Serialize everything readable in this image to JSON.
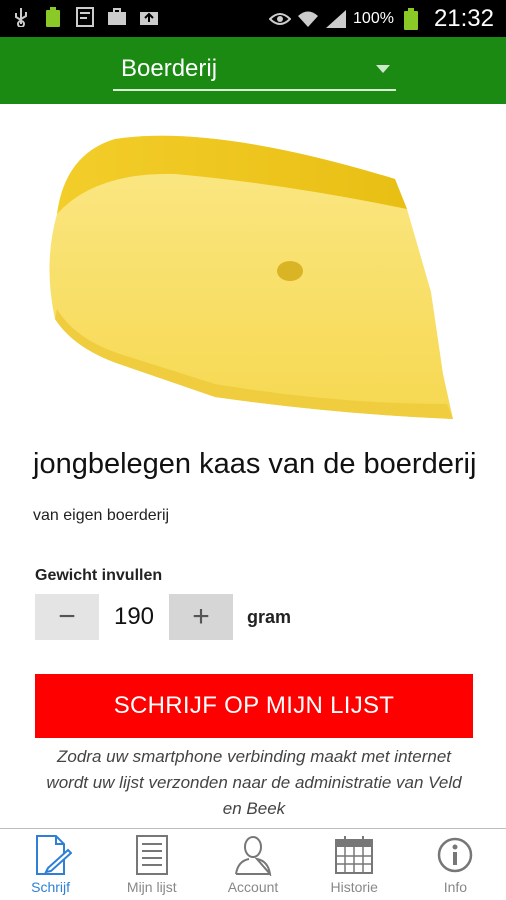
{
  "status_bar": {
    "battery_percent": "100%",
    "time": "21:32",
    "icons": [
      "usb-icon",
      "battery-icon",
      "notification-icon",
      "briefcase-icon",
      "upload-icon",
      "eye-icon",
      "wifi-icon",
      "signal-icon"
    ]
  },
  "app_bar": {
    "selected": "Boerderij",
    "background": "#1a8a12"
  },
  "product": {
    "title": "jongbelegen kaas van de boerderij",
    "subtitle": "van eigen boerderij",
    "image_icon": "cheese-image"
  },
  "weight": {
    "label": "Gewicht invullen",
    "value": "190",
    "unit": "gram",
    "minus_symbol": "−",
    "plus_symbol": "+"
  },
  "submit": {
    "label": "SCHRIJF OP MIJN LIJST",
    "color": "#ff0000"
  },
  "notice": "Zodra uw smartphone verbinding maakt met internet wordt uw lijst verzonden naar de administratie van Veld en Beek",
  "nav": [
    {
      "label": "Schrijf",
      "icon": "write-icon",
      "active": true
    },
    {
      "label": "Mijn lijst",
      "icon": "list-icon",
      "active": false
    },
    {
      "label": "Account",
      "icon": "account-icon",
      "active": false
    },
    {
      "label": "Historie",
      "icon": "calendar-icon",
      "active": false
    },
    {
      "label": "Info",
      "icon": "info-icon",
      "active": false
    }
  ],
  "colors": {
    "accent": "#2f7fd6"
  }
}
